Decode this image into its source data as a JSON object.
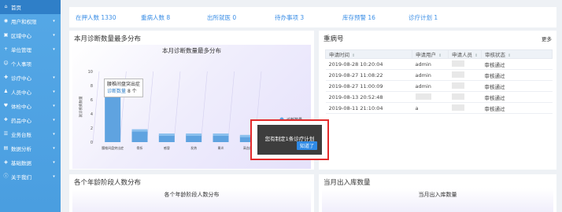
{
  "sidebar": {
    "items": [
      {
        "label": "首页",
        "icon": "home-icon",
        "active": true,
        "has_chevron": false
      },
      {
        "label": "用户和权限",
        "icon": "user-icon",
        "has_chevron": true
      },
      {
        "label": "区域中心",
        "icon": "region-icon",
        "has_chevron": true
      },
      {
        "label": "单位管理",
        "icon": "plus-icon",
        "has_chevron": true
      },
      {
        "label": "个人事项",
        "icon": "person-icon",
        "has_chevron": false
      },
      {
        "label": "诊疗中心",
        "icon": "treatment-icon",
        "has_chevron": true
      },
      {
        "label": "人员中心",
        "icon": "staff-icon",
        "has_chevron": true
      },
      {
        "label": "体检中心",
        "icon": "heart-icon",
        "has_chevron": true
      },
      {
        "label": "药品中心",
        "icon": "medicine-icon",
        "has_chevron": true
      },
      {
        "label": "业务台账",
        "icon": "ledger-icon",
        "has_chevron": true
      },
      {
        "label": "数据分析",
        "icon": "analysis-icon",
        "has_chevron": true
      },
      {
        "label": "基础数据",
        "icon": "database-icon",
        "has_chevron": true
      },
      {
        "label": "关于我们",
        "icon": "info-icon",
        "has_chevron": true
      }
    ]
  },
  "stats": [
    {
      "label": "在押人数",
      "value": "1330"
    },
    {
      "label": "重病人数",
      "value": "8"
    },
    {
      "label": "出所就医",
      "value": "0"
    },
    {
      "label": "待办事项",
      "value": "3"
    },
    {
      "label": "库存预警",
      "value": "16"
    },
    {
      "label": "诊疗计划",
      "value": "1"
    }
  ],
  "chart_panel": {
    "title": "本月诊断数量最多分布",
    "tooltip": {
      "title": "腰椎间盘突出症",
      "series": "诊断数量",
      "value": "8 个"
    }
  },
  "chart_data": {
    "type": "bar",
    "title": "本月诊断数量最多分布",
    "categories": [
      "腰椎间盘突出症",
      "骨折",
      "感冒",
      "发热",
      "胃炎",
      "高血压"
    ],
    "category_tick_labels": [
      "腰椎间盘突出症",
      "骨折",
      "感冒",
      "发热",
      "胃炎",
      "高血压"
    ],
    "series": [
      {
        "name": "诊断数量",
        "values": [
          8,
          1.6,
          1,
          1,
          1,
          0.8
        ]
      }
    ],
    "ylabel": "就诊疾病数量",
    "yticks": [
      10,
      8,
      6,
      4,
      2,
      0
    ],
    "ylim": [
      0,
      10
    ],
    "legend": "right",
    "bar_color": "#5fa3e0"
  },
  "table_panel": {
    "title": "重病号",
    "more": "更多",
    "columns": [
      "申请时间",
      "申请用户",
      "申请人员",
      "审核状态"
    ],
    "rows": [
      {
        "time": "2019-08-28 10:20:04",
        "user": "admin",
        "person": "",
        "status": "审核通过"
      },
      {
        "time": "2019-08-27 11:08:22",
        "user": "admin",
        "person": "",
        "status": "审核通过"
      },
      {
        "time": "2019-08-27 11:00:09",
        "user": "admin",
        "person": "",
        "status": "审核通过"
      },
      {
        "time": "2019-08-13 20:52:48",
        "user": "",
        "person": "",
        "status": "审核通过"
      },
      {
        "time": "2019-08-11 21:10:04",
        "user": "a",
        "person": "",
        "status": "审核通过"
      }
    ]
  },
  "age_panel": {
    "title": "各个年龄阶段人数分布",
    "chart_title": "各个年龄阶段人数分布"
  },
  "stock_panel": {
    "title": "当月出入库数量",
    "chart_title": "当月出入库数量"
  },
  "modal": {
    "text": "您有制定1条诊疗计划",
    "button": "知道了"
  },
  "colors": {
    "accent": "#3a8ee6",
    "sidebar": "#4a9ee0",
    "highlight_border": "#e32a2a"
  }
}
